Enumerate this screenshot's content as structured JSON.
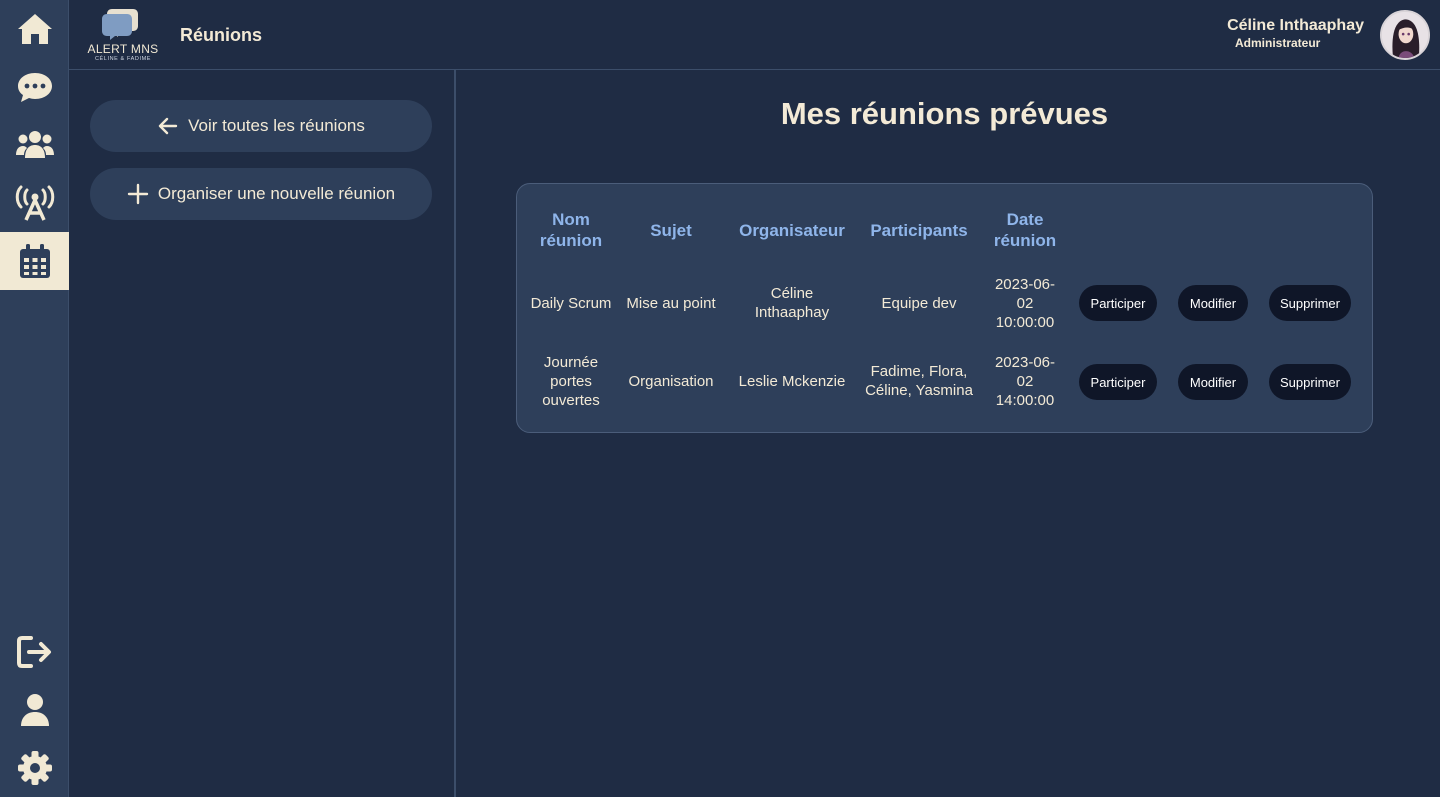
{
  "header": {
    "logo_text": "ALERT MNS",
    "logo_subtext": "CÉLINE & FADIME",
    "page_title": "Réunions",
    "user_name": "Céline Inthaaphay",
    "user_role": "Administrateur"
  },
  "rail": {
    "items": [
      {
        "icon": "home-icon"
      },
      {
        "icon": "chat-icon"
      },
      {
        "icon": "users-icon"
      },
      {
        "icon": "broadcast-icon"
      },
      {
        "icon": "calendar-icon",
        "active": true
      },
      {
        "icon": "logout-icon"
      },
      {
        "icon": "user-icon"
      },
      {
        "icon": "gear-icon"
      }
    ]
  },
  "side_panel": {
    "view_all_label": "Voir toutes les réunions",
    "new_meeting_label": "Organiser une nouvelle réunion"
  },
  "main": {
    "title": "Mes réunions prévues",
    "columns": [
      "Nom réunion",
      "Sujet",
      "Organisateur",
      "Participants",
      "Date réunion"
    ],
    "rows": [
      {
        "name": "Daily Scrum",
        "subject": "Mise au point",
        "organizer": "Céline Inthaaphay",
        "participants": "Equipe dev",
        "date": "2023-06-02 10:00:00",
        "actions": [
          "Participer",
          "Modifier",
          "Supprimer"
        ]
      },
      {
        "name": "Journée portes ouvertes",
        "subject": "Organisation",
        "organizer": "Leslie Mckenzie",
        "participants": "Fadime, Flora, Céline, Yasmina",
        "date": "2023-06-02 14:00:00",
        "actions": [
          "Participer",
          "Modifier",
          "Supprimer"
        ]
      }
    ]
  },
  "colors": {
    "background": "#1f2c44",
    "rail": "#2e3f5a",
    "accent_cream": "#f1e9d4",
    "header_blue": "#8fb5ea",
    "button_dark": "#0f1628"
  }
}
